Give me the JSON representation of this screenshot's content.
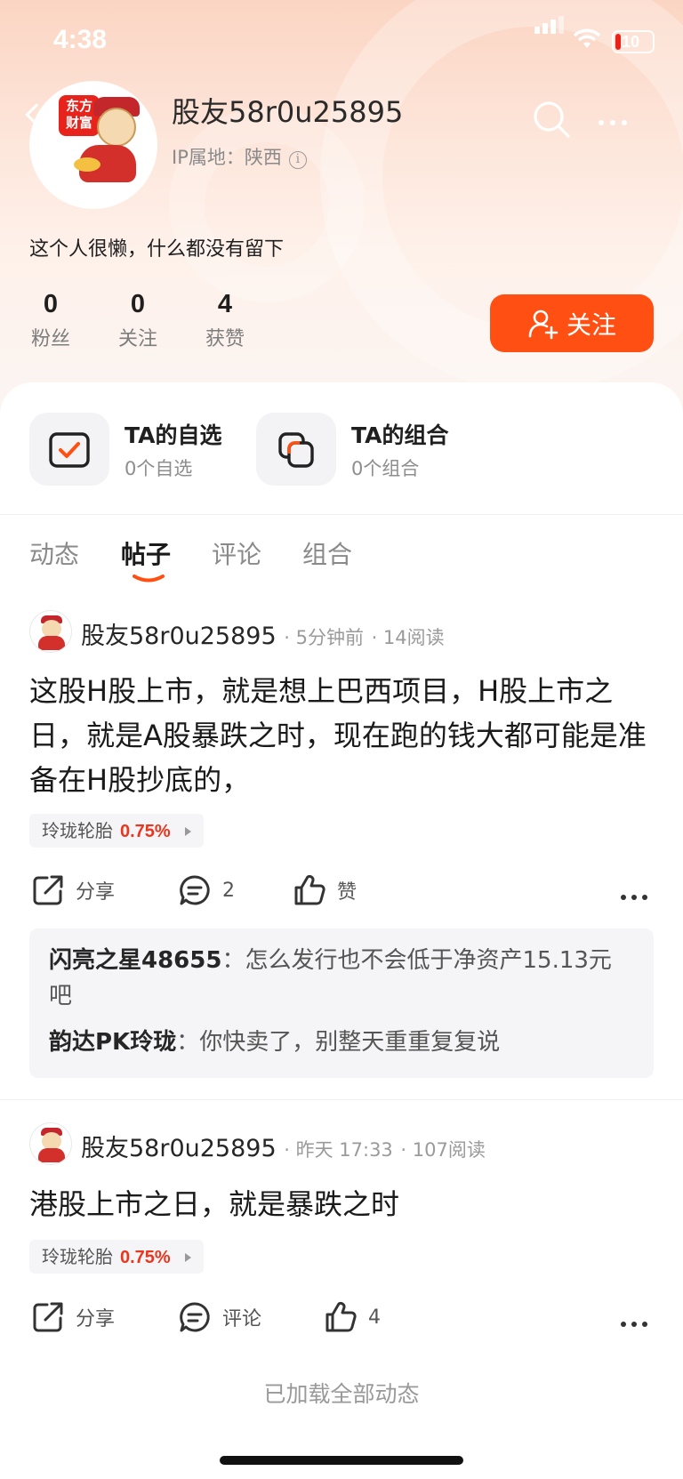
{
  "status_bar": {
    "time": "4:38",
    "battery": "10"
  },
  "profile": {
    "avatar_badge": "东方财富",
    "username": "股友58r0u25895",
    "ip_location": "IP属地：陕西",
    "bio": "这个人很懒，什么都没有留下",
    "stats": [
      {
        "value": "0",
        "label": "粉丝"
      },
      {
        "value": "0",
        "label": "关注"
      },
      {
        "value": "4",
        "label": "获赞"
      }
    ],
    "follow_label": "关注"
  },
  "quick_links": [
    {
      "title": "TA的自选",
      "subtitle": "0个自选"
    },
    {
      "title": "TA的组合",
      "subtitle": "0个组合"
    }
  ],
  "tabs": [
    {
      "label": "动态",
      "active": false
    },
    {
      "label": "帖子",
      "active": true
    },
    {
      "label": "评论",
      "active": false
    },
    {
      "label": "组合",
      "active": false
    }
  ],
  "posts": [
    {
      "author": "股友58r0u25895",
      "time": "5分钟前",
      "reads": "14阅读",
      "text": "这股H股上市，就是想上巴西项目，H股上市之日，就是A股暴跌之时，现在跑的钱大都可能是准备在H股抄底的，",
      "stock_name": "玲珑轮胎",
      "stock_change": "0.75%",
      "share_label": "分享",
      "comment_label": "2",
      "like_label": "赞",
      "comments": [
        {
          "author": "闪亮之星48655",
          "sep": "：",
          "text": "怎么发行也不会低于净资产15.13元吧"
        },
        {
          "author": "韵达PK玲珑",
          "sep": "：",
          "text": "你快卖了，别整天重重复复说"
        }
      ]
    },
    {
      "author": "股友58r0u25895",
      "time": "昨天 17:33",
      "reads": "107阅读",
      "text": "港股上市之日，就是暴跌之时",
      "stock_name": "玲珑轮胎",
      "stock_change": "0.75%",
      "share_label": "分享",
      "comment_label": "评论",
      "like_label": "4"
    }
  ],
  "footer": "已加载全部动态",
  "colors": {
    "accent": "#ff4f12",
    "up": "#e8361f"
  }
}
